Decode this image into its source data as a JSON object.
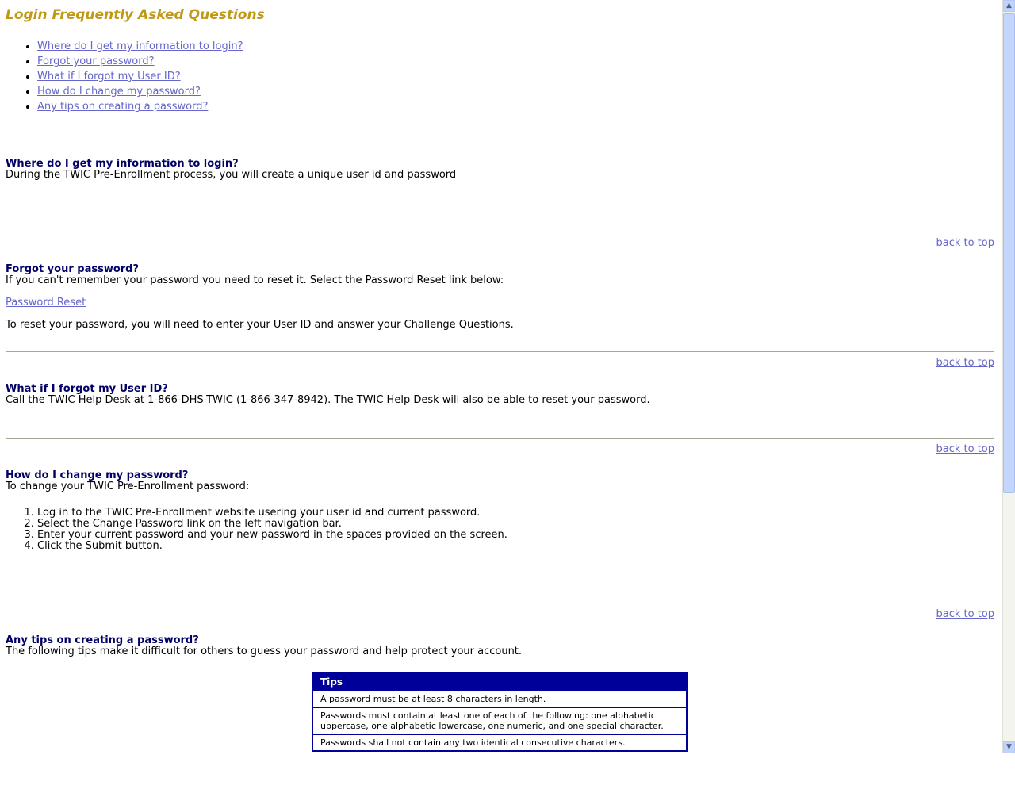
{
  "title": "Login Frequently Asked Questions",
  "toc": [
    "Where do I get my information to login?",
    "Forgot your password?",
    "What if I forgot my User ID?",
    "How do I change my password?",
    "Any tips on creating a password?"
  ],
  "back_to_top": "back to top",
  "sections": {
    "login_info": {
      "title": "Where do I get my information to login?",
      "text": "During the TWIC Pre-Enrollment process, you will create a unique user id and password"
    },
    "forgot_password": {
      "title": "Forgot your password?",
      "text": "If you can't remember your password you need to reset it. Select the Password Reset link below:",
      "link": "Password Reset",
      "text2": "To reset your password, you will need to enter your User ID and answer your Challenge Questions."
    },
    "forgot_userid": {
      "title": "What if I forgot my User ID?",
      "text": "Call the TWIC Help Desk at 1-866-DHS-TWIC (1-866-347-8942). The TWIC Help Desk will also be able to reset your password."
    },
    "change_password": {
      "title": "How do I change my password?",
      "text": "To change your TWIC Pre-Enrollment password:",
      "steps": [
        "Log in to the TWIC Pre-Enrollment website usering your user id and current password.",
        "Select the Change Password link on the left navigation bar.",
        "Enter your current password and your new password in the spaces provided on the screen.",
        "Click the Submit button."
      ]
    },
    "tips": {
      "title": "Any tips on creating a password?",
      "text": "The following tips make it difficult for others to guess your password and help protect your account.",
      "table_header": "Tips",
      "rows": [
        "A password must be at least 8 characters in length.",
        "Passwords must contain at least one of each of the following: one alphabetic uppercase, one alphabetic lowercase, one numeric, and one special character.",
        "Passwords shall not contain any two identical consecutive characters."
      ]
    }
  },
  "scrollbar": {
    "up_arrow_icon": "chevron-up-icon",
    "down_arrow_icon": "chevron-down-icon"
  },
  "colors": {
    "title": "#c09a14",
    "question": "#000066",
    "link": "#6666cc",
    "tips_header": "#000099"
  }
}
